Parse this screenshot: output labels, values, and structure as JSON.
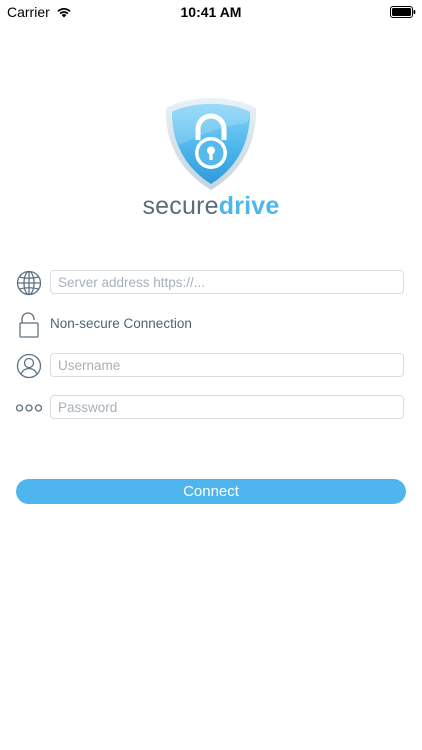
{
  "status_bar": {
    "carrier": "Carrier",
    "time": "10:41 AM"
  },
  "logo": {
    "word_secure": "secure",
    "word_drive": "drive"
  },
  "form": {
    "server_placeholder": "Server address https://...",
    "connection_status": "Non-secure Connection",
    "username_placeholder": "Username",
    "password_placeholder": "Password",
    "connect_label": "Connect"
  },
  "colors": {
    "accent": "#4fb5ef",
    "shield": "#4db6ec",
    "text_muted": "#5a6b7a"
  },
  "icons": {
    "server": "globe-icon",
    "connection": "unlocked-padlock-icon",
    "username": "user-icon",
    "password": "dots-icon"
  }
}
